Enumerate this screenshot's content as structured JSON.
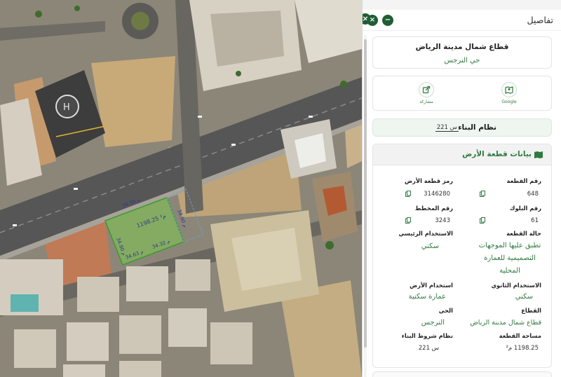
{
  "panel": {
    "title": "تفاصيل",
    "close_symbol": "×",
    "minimize_symbol": "−"
  },
  "parcel": {
    "district_sector": "قطاع شمال مدينة الرياض",
    "neighborhood": "حي النرجس"
  },
  "actions": {
    "google_label": "Google",
    "share_label": "مشاركة"
  },
  "building_system": {
    "label": "نظام البناء",
    "value": "س 221"
  },
  "land_data": {
    "header": "بيانات قطعة الأرض",
    "fields": {
      "parcel_no_label": "رقم القطعة",
      "parcel_no_value": "648",
      "parcel_code_label": "رمز قطعة الأرض",
      "parcel_code_value": "3146280",
      "block_no_label": "رقم البلوك",
      "block_no_value": "61",
      "plan_no_label": "رقم المخطط",
      "plan_no_value": "3243",
      "status_label": "حالة القطعة",
      "status_line1": "تطبق عليها الموجهات",
      "status_line2": "التصميمية للعمارة",
      "status_line3": "المحلية",
      "main_use_label": "الاستخدام الرئيسي",
      "main_use_value": "سكني",
      "secondary_use_label": "الاستخدام الثانوي",
      "secondary_use_value": "سكني",
      "land_use_label": "استخدام الأرض",
      "land_use_value": "عمارة سكنية",
      "sector_label": "القطاع",
      "sector_value": "قطاع شمال مدينة الرياض",
      "district_label": "الحي",
      "district_value": "النرجس",
      "area_label": "مساحة القطعة",
      "area_value": "1198.25 م²",
      "conditions_label": "نظام شروط البناء",
      "conditions_value": "س 221"
    }
  },
  "map": {
    "parcel_area_label": "1198.25 م²",
    "dim_top": "34.39 م",
    "dim_right": "34.90 م",
    "dim_bottom": "34.32 م",
    "dim_left": "34.63 م",
    "dim_left_side": "34.90 م",
    "colors": {
      "accent": "#1f5e35",
      "parcel_fill": "#7fbf55",
      "text_green": "#2f7a40"
    }
  }
}
